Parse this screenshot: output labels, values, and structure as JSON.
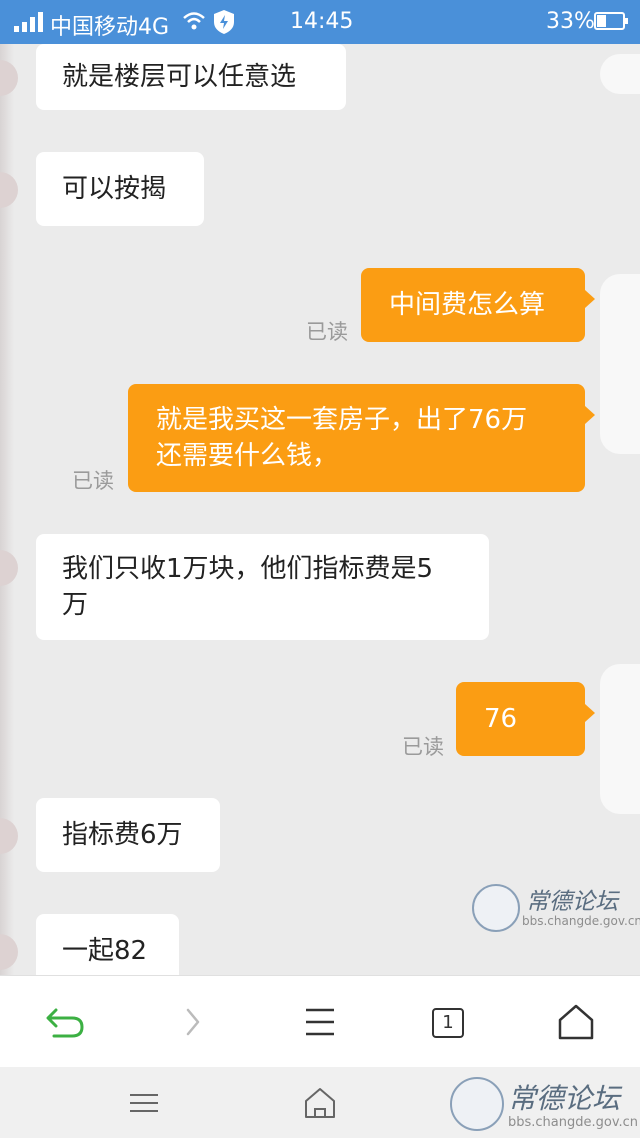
{
  "status_bar": {
    "carrier": "中国移动4G",
    "time": "14:45",
    "battery": "33%"
  },
  "chat": {
    "messages": [
      {
        "dir": "in",
        "lines": [
          "就是楼层可以任意选"
        ]
      },
      {
        "dir": "in",
        "lines": [
          "可以按揭"
        ]
      },
      {
        "dir": "out",
        "lines": [
          "中间费怎么算"
        ],
        "status": "已读"
      },
      {
        "dir": "out",
        "lines": [
          "就是我买这一套房子，出了76万",
          "还需要什么钱，"
        ],
        "status": "已读"
      },
      {
        "dir": "in",
        "lines": [
          "我们只收1万块，他们指标费是5",
          "万"
        ]
      },
      {
        "dir": "out",
        "lines": [
          "76"
        ],
        "status": "已读"
      },
      {
        "dir": "in",
        "lines": [
          "指标费6万"
        ]
      },
      {
        "dir": "in",
        "lines": [
          "一起82"
        ]
      }
    ]
  },
  "watermark": {
    "title": "常德论坛",
    "url": "bbs.changde.gov.cn"
  },
  "toolbar": {
    "tab_count": "1",
    "icons": [
      "back-icon",
      "forward-icon",
      "menu-icon",
      "tabs-icon",
      "home-icon"
    ]
  },
  "navbar": {
    "icons": [
      "menu-icon",
      "home-icon"
    ]
  },
  "colors": {
    "status_bar": "#4a90d9",
    "outgoing_bubble": "#fb9d13",
    "incoming_bubble": "#ffffff",
    "chat_background": "#ebebeb",
    "back_icon": "#3cb043"
  }
}
